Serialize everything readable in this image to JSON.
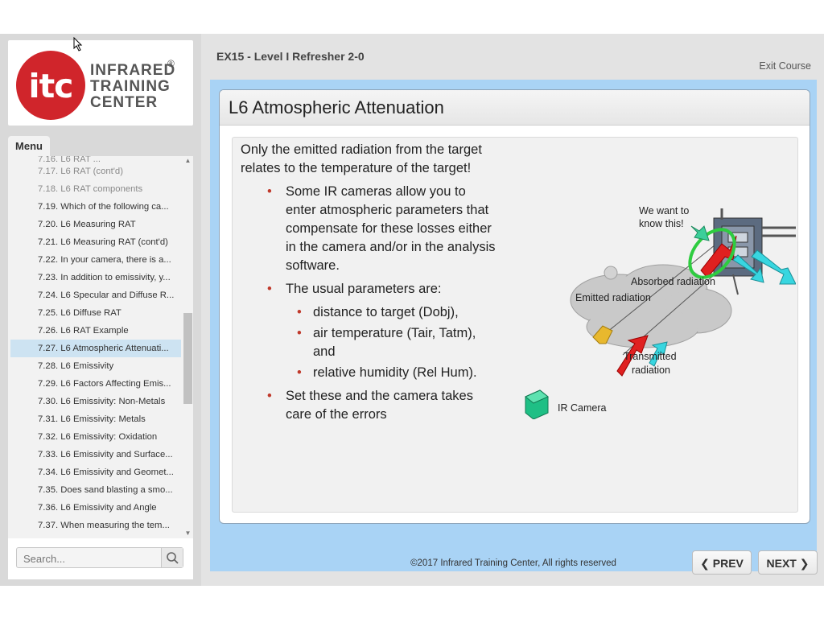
{
  "header": {
    "course_title": "EX15 - Level I Refresher 2-0",
    "exit_label": "Exit Course"
  },
  "logo": {
    "mark": "itc",
    "line1": "INFRARED",
    "line2": "TRAINING",
    "line3": "CENTER",
    "registered": "®"
  },
  "sidebar": {
    "menu_tab": "Menu",
    "items": [
      {
        "label": "7.16. L6 RAT ...",
        "state": "partial"
      },
      {
        "label": "7.17. L6 RAT (cont'd)",
        "state": "visited"
      },
      {
        "label": "7.18. L6 RAT components",
        "state": "visited"
      },
      {
        "label": "7.19. Which of the following ca...",
        "state": "normal"
      },
      {
        "label": "7.20. L6 Measuring RAT",
        "state": "normal"
      },
      {
        "label": "7.21. L6 Measuring RAT (cont'd)",
        "state": "normal"
      },
      {
        "label": "7.22. In your camera, there is a...",
        "state": "normal"
      },
      {
        "label": "7.23. In addition to emissivity, y...",
        "state": "normal"
      },
      {
        "label": "7.24. L6 Specular and Diffuse R...",
        "state": "normal"
      },
      {
        "label": "7.25. L6 Diffuse RAT",
        "state": "normal"
      },
      {
        "label": "7.26. L6 RAT Example",
        "state": "normal"
      },
      {
        "label": "7.27. L6 Atmospheric Attenuati...",
        "state": "active"
      },
      {
        "label": "7.28. L6 Emissivity",
        "state": "normal"
      },
      {
        "label": "7.29. L6 Factors Affecting Emis...",
        "state": "normal"
      },
      {
        "label": "7.30. L6 Emissivity: Non-Metals",
        "state": "normal"
      },
      {
        "label": "7.31. L6 Emissivity: Metals",
        "state": "normal"
      },
      {
        "label": "7.32. L6 Emissivity: Oxidation",
        "state": "normal"
      },
      {
        "label": "7.33. L6 Emissivity and Surface...",
        "state": "normal"
      },
      {
        "label": "7.34. L6 Emissivity and Geomet...",
        "state": "normal"
      },
      {
        "label": "7.35. Does sand blasting a smo...",
        "state": "normal"
      },
      {
        "label": "7.36. L6 Emissivity and Angle",
        "state": "normal"
      },
      {
        "label": "7.37. When measuring the tem...",
        "state": "normal"
      }
    ],
    "search": {
      "placeholder": "Search..."
    }
  },
  "slide": {
    "title": "L6  Atmospheric Attenuation",
    "intro": "Only the emitted radiation from the target relates to the temperature of the target!",
    "bullets": [
      "Some IR cameras allow you to enter atmospheric parameters that compensate for these losses either in the camera and/or in the analysis software.",
      "The usual parameters are:"
    ],
    "sub_bullets": [
      "distance to target (Dobj),",
      "air temperature (Tair, Tatm), and",
      "relative humidity (Rel Hum)."
    ],
    "final_bullet": "Set these and the camera takes care of the errors",
    "diagram": {
      "we_want_line1": "We want to",
      "we_want_line2": "know this!",
      "absorbed": "Absorbed radiation",
      "emitted": "Emitted radiation",
      "transmitted_line1": "Transmitted",
      "transmitted_line2": "radiation",
      "ir_camera": "IR Camera"
    }
  },
  "footer": {
    "copyright": "©2017 Infrared Training Center, All rights reserved"
  },
  "nav": {
    "prev": "PREV",
    "next": "NEXT"
  }
}
